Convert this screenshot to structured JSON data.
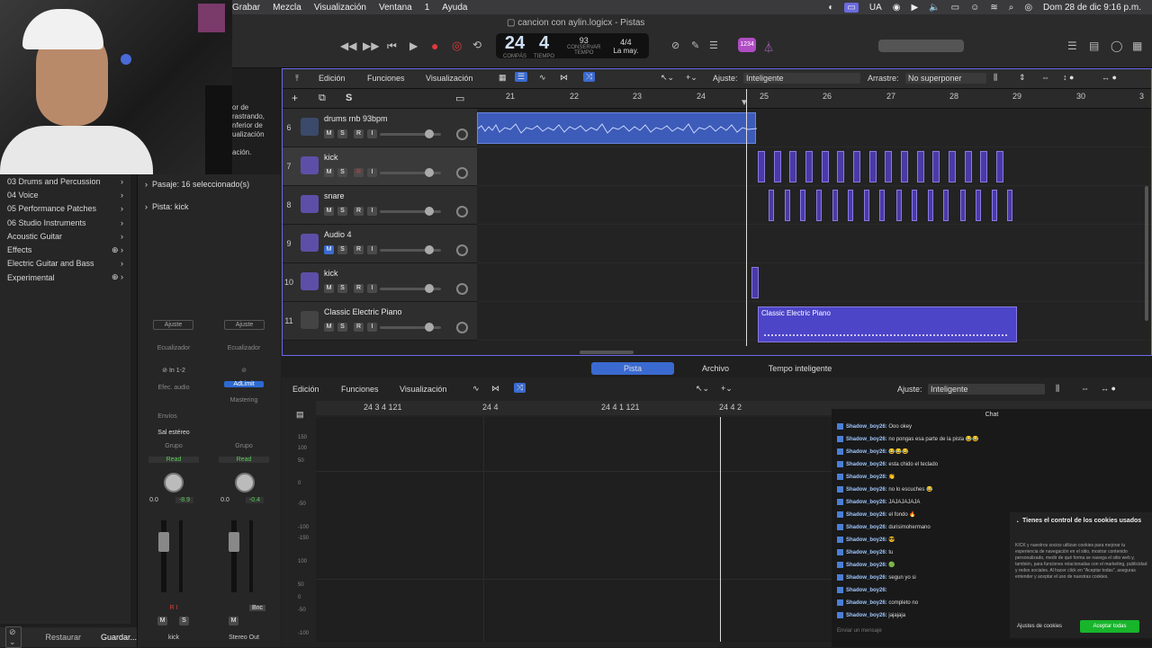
{
  "menubar": {
    "items": [
      "Grabar",
      "Mezcla",
      "Visualización",
      "Ventana",
      "1",
      "Ayuda"
    ],
    "right": {
      "lang": "UA",
      "datetime": "Dom 28 de dic  9:16 p.m."
    }
  },
  "window": {
    "title": "cancion con aylin.logicx - Pistas"
  },
  "lcd": {
    "bar": "24",
    "beat": "4",
    "bar_label": "COMPÁS",
    "beat_label": "TIEMPO",
    "tempo": "93",
    "tempo_label": "CONSERVAR",
    "tempo_sub": "TEMPO",
    "sig": "4/4",
    "key": "La may."
  },
  "badge": "1234",
  "library": {
    "items": [
      {
        "label": "03 Drums and Percussion",
        "icon": "chevron-right-icon"
      },
      {
        "label": "04 Voice",
        "icon": "chevron-right-icon"
      },
      {
        "label": "05 Performance Patches",
        "icon": "chevron-right-icon"
      },
      {
        "label": "06 Studio Instruments",
        "icon": "chevron-right-icon"
      },
      {
        "label": "Acoustic Guitar",
        "icon": "chevron-right-icon"
      },
      {
        "label": "Effects",
        "icon": "download-chevron-icon"
      },
      {
        "label": "Electric Guitar and Bass",
        "icon": "chevron-right-icon"
      },
      {
        "label": "Experimental",
        "icon": "download-chevron-icon"
      }
    ],
    "partial_text": [
      "or de",
      "rastrando,",
      "nferior de",
      "ualización",
      "ación."
    ],
    "restore": "Restaurar",
    "save": "Guardar..."
  },
  "inspector": {
    "region": "Pasaje:  16 seleccionado(s)",
    "track": "Pista:  kick",
    "strip1": {
      "setting": "Ajuste",
      "eq": "Ecualizador",
      "input": "In 1-2",
      "fx": "Efec. audio",
      "sends": "Envíos",
      "out": "Sal estéreo",
      "group": "Grupo",
      "auto": "Read",
      "vol": "0.0",
      "peak": "-8.9",
      "name": "kick"
    },
    "strip2": {
      "setting": "Ajuste",
      "eq": "Ecualizador",
      "fx": "AdLimit",
      "mastering": "Mastering",
      "group": "Grupo",
      "auto": "Read",
      "vol": "0.0",
      "peak": "-0.4",
      "bnc": "Bnc",
      "name": "Stereo Out"
    }
  },
  "tracks_toolbar": {
    "edit": "Edición",
    "functions": "Funciones",
    "view": "Visualización",
    "snap_label": "Ajuste:",
    "snap_value": "Inteligente",
    "drag_label": "Arrastre:",
    "drag_value": "No superponer"
  },
  "ruler": [
    "21",
    "22",
    "23",
    "24",
    "25",
    "26",
    "27",
    "28",
    "29",
    "30",
    "3"
  ],
  "tracks": [
    {
      "num": "6",
      "name": "drums rnb 93bpm"
    },
    {
      "num": "7",
      "name": "kick"
    },
    {
      "num": "8",
      "name": "snare"
    },
    {
      "num": "9",
      "name": "Audio 4"
    },
    {
      "num": "10",
      "name": "kick"
    },
    {
      "num": "11",
      "name": "Classic Electric Piano"
    }
  ],
  "regions": {
    "piano": "Classic Electric Piano"
  },
  "editor": {
    "tabs": [
      "Pista",
      "Archivo",
      "Tempo inteligente"
    ],
    "edit": "Edición",
    "functions": "Funciones",
    "view": "Visualización",
    "snap_label": "Ajuste:",
    "snap_value": "Inteligente",
    "ruler": [
      "24 3 4 121",
      "24 4",
      "24 4 1 121",
      "24 4 2"
    ],
    "ylabels": [
      "150",
      "100",
      "50",
      "0",
      "-50",
      "-100",
      "-150",
      "100",
      "50",
      "0",
      "-50",
      "-100"
    ]
  },
  "chat": {
    "title": "Chat",
    "lines": [
      {
        "user": "Shadow_boy26:",
        "msg": "Ooo okey"
      },
      {
        "user": "Shadow_boy26:",
        "msg": "no pongas esa parte de la pista 😂😂"
      },
      {
        "user": "Shadow_boy26:",
        "msg": "😂😂😂"
      },
      {
        "user": "Shadow_boy26:",
        "msg": "esta chido el teclado"
      },
      {
        "user": "Shadow_boy26:",
        "msg": "👏"
      },
      {
        "user": "Shadow_boy26:",
        "msg": "no lo escuches 😂"
      },
      {
        "user": "Shadow_boy26:",
        "msg": "JAJAJAJAJA"
      },
      {
        "user": "Shadow_boy26:",
        "msg": "el fondo 🔥"
      },
      {
        "user": "Shadow_boy26:",
        "msg": "durisimohermano"
      },
      {
        "user": "Shadow_boy26:",
        "msg": "😎"
      },
      {
        "user": "Shadow_boy26:",
        "msg": "tu"
      },
      {
        "user": "Shadow_boy26:",
        "msg": "🟢"
      },
      {
        "user": "Shadow_boy26:",
        "msg": "segun yo si"
      },
      {
        "user": "Shadow_boy26:",
        "msg": ""
      },
      {
        "user": "Shadow_boy26:",
        "msg": "completo no"
      },
      {
        "user": "Shadow_boy26:",
        "msg": "jajajaja"
      }
    ],
    "placeholder": "Enviar un mensaje"
  },
  "cookie": {
    "title": "Tienes el control de los cookies usados",
    "body": "KICK y nuestros socios utilizan cookies para mejorar tu experiencia de navegación en el sitio, mostrar contenido personalizado, medir de qué forma se navega el sitio web y, también, para funciones relacionadas con el marketing, publicidad y redes sociales. Al hacer click en \"Aceptar todas\", aseguras entender y aceptar el uso de nuestras cookies.",
    "settings": "Ajustes de cookies",
    "accept": "Aceptar todas"
  },
  "colors": {
    "accent": "#3d5bb8",
    "midi": "#4a3aa8",
    "record": "#e03a3a",
    "chat_user": "#9ec7ff",
    "cookie_accept": "#18b52b"
  }
}
